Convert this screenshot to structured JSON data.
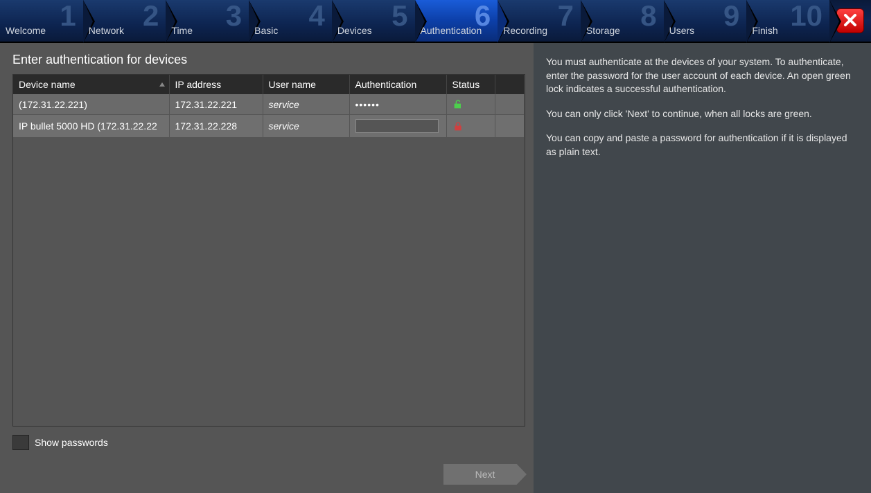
{
  "nav": {
    "steps": [
      {
        "num": "1",
        "label": "Welcome"
      },
      {
        "num": "2",
        "label": "Network"
      },
      {
        "num": "3",
        "label": "Time"
      },
      {
        "num": "4",
        "label": "Basic"
      },
      {
        "num": "5",
        "label": "Devices"
      },
      {
        "num": "6",
        "label": "Authentication"
      },
      {
        "num": "7",
        "label": "Recording"
      },
      {
        "num": "8",
        "label": "Storage"
      },
      {
        "num": "9",
        "label": "Users"
      },
      {
        "num": "10",
        "label": "Finish"
      }
    ],
    "active_index": 5
  },
  "page": {
    "title": "Enter authentication for devices",
    "columns": {
      "device_name": "Device name",
      "ip_address": "IP address",
      "user_name": "User name",
      "authentication": "Authentication",
      "status": "Status"
    },
    "rows": [
      {
        "device_name": " (172.31.22.221)",
        "ip": "172.31.22.221",
        "user": "service",
        "pwd_display": "••••••",
        "status": "open"
      },
      {
        "device_name": "IP bullet 5000 HD (172.31.22.22",
        "ip": "172.31.22.228",
        "user": "service",
        "pwd_display": "",
        "status": "closed"
      }
    ],
    "show_passwords_label": "Show passwords",
    "next_button": "Next"
  },
  "help": {
    "p1": "You must authenticate at the devices of your system. To authenticate, enter the password for the user account of each device. An open green lock indicates a successful authentication.",
    "p2": "You can only click 'Next' to continue, when all locks are green.",
    "p3": "You can copy and paste a password for authentication if it is displayed as plain text."
  }
}
